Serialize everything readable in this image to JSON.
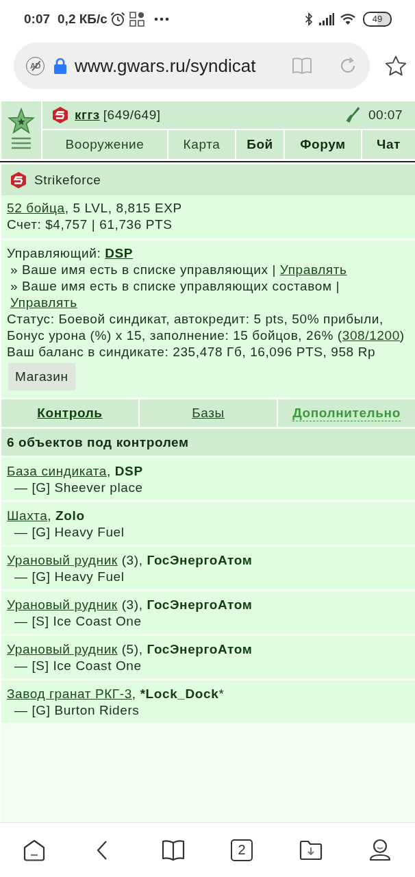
{
  "status_bar": {
    "time": "0:07",
    "speed": "0,2 КБ/с",
    "battery": "49"
  },
  "browser": {
    "ad_block": "AD",
    "url": "www.gwars.ru/syndicat",
    "tab_count": "2"
  },
  "header": {
    "user": "кггз",
    "hp": "[649/649]",
    "clock": "00:07",
    "nav": [
      {
        "label": "Вооружение",
        "emphasized": false
      },
      {
        "label": "Карта",
        "emphasized": false
      },
      {
        "label": "Бой",
        "emphasized": true
      },
      {
        "label": "Форум",
        "emphasized": true
      },
      {
        "label": "Чат",
        "emphasized": true
      }
    ]
  },
  "syndicate": {
    "name": "Strikeforce",
    "fighters": "52 бойца",
    "stats": ", 5 LVL, 8,815 EXP",
    "account": "Счет: $4,757 | 61,736 PTS"
  },
  "management": {
    "manager_label": "Управляющий:",
    "manager": "DSP",
    "notes": [
      {
        "text": "» Ваше имя есть в списке управляющих |",
        "link": "Управлять"
      },
      {
        "text": "» Ваше имя есть в списке управляющих составом |",
        "link": "Управлять"
      }
    ],
    "status_text": "Статус: Боевой синдикат, автокредит: 5 pts, 50% прибыли, Бонус урона (%) x 15, заполнение: 15 бойцов, 26% (",
    "status_link": "308/1200",
    "status_end": ")",
    "balance": "Ваш баланс в синдикате: 235,478 Гб, 16,096 PTS, 958 Rp",
    "shop_button": "Магазин"
  },
  "tabs": [
    {
      "label": "Контроль",
      "kind": "link",
      "selected": true
    },
    {
      "label": "Базы",
      "kind": "link",
      "selected": false
    },
    {
      "label": "Дополнительно",
      "kind": "toggle",
      "selected": false
    }
  ],
  "objects": {
    "title": "6 объектов под контролем",
    "items": [
      {
        "link": "База синдиката",
        "rest": ", **DSP**",
        "base": "— [G] Sheever place"
      },
      {
        "link": "Шахта",
        "rest": ", **Zolo**",
        "base": "— [G] Heavy Fuel"
      },
      {
        "link": "Урановый рудник",
        "rest": " (3), **ГосЭнергоАтом**",
        "base": "— [G] Heavy Fuel"
      },
      {
        "link": "Урановый рудник",
        "rest": " (3), **ГосЭнергоАтом**",
        "base": "— [S] Ice Coast One"
      },
      {
        "link": "Урановый рудник",
        "rest": " (5), **ГосЭнергоАтом**",
        "base": "— [S] Ice Coast One"
      },
      {
        "link": "Завод гранат РКГ-3",
        "rest": ", ***Lock_Dock***",
        "base": "— [G] Burton Riders"
      }
    ]
  }
}
